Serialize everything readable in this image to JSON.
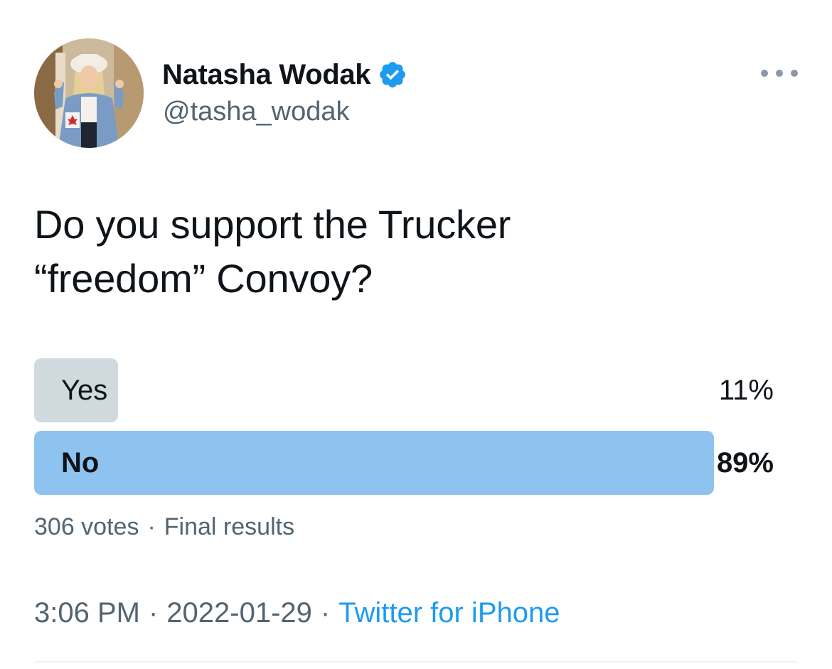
{
  "author": {
    "display_name": "Natasha Wodak",
    "handle": "@tasha_wodak",
    "verified": true,
    "avatar_icon": "profile-photo"
  },
  "tweet": {
    "text_lines": [
      "Do you support the Trucker",
      "“freedom” Convoy?"
    ]
  },
  "poll": {
    "options": [
      {
        "label": "Yes",
        "percent_text": "11%",
        "percent": 11,
        "winner": false
      },
      {
        "label": "No",
        "percent_text": "89%",
        "percent": 89,
        "winner": true
      }
    ],
    "votes": "306 votes",
    "separator": "·",
    "status": "Final results"
  },
  "meta": {
    "time": "3:06 PM",
    "date": "2022-01-29",
    "separator": "·",
    "source": "Twitter for iPhone"
  },
  "colors": {
    "accent": "#1d9bf0",
    "winner_bar": "#8ec3f0",
    "loser_bar": "#cfd9de",
    "secondary_text": "#536471"
  },
  "icons": {
    "verified": "verified-badge-icon",
    "more": "more-options-icon"
  }
}
